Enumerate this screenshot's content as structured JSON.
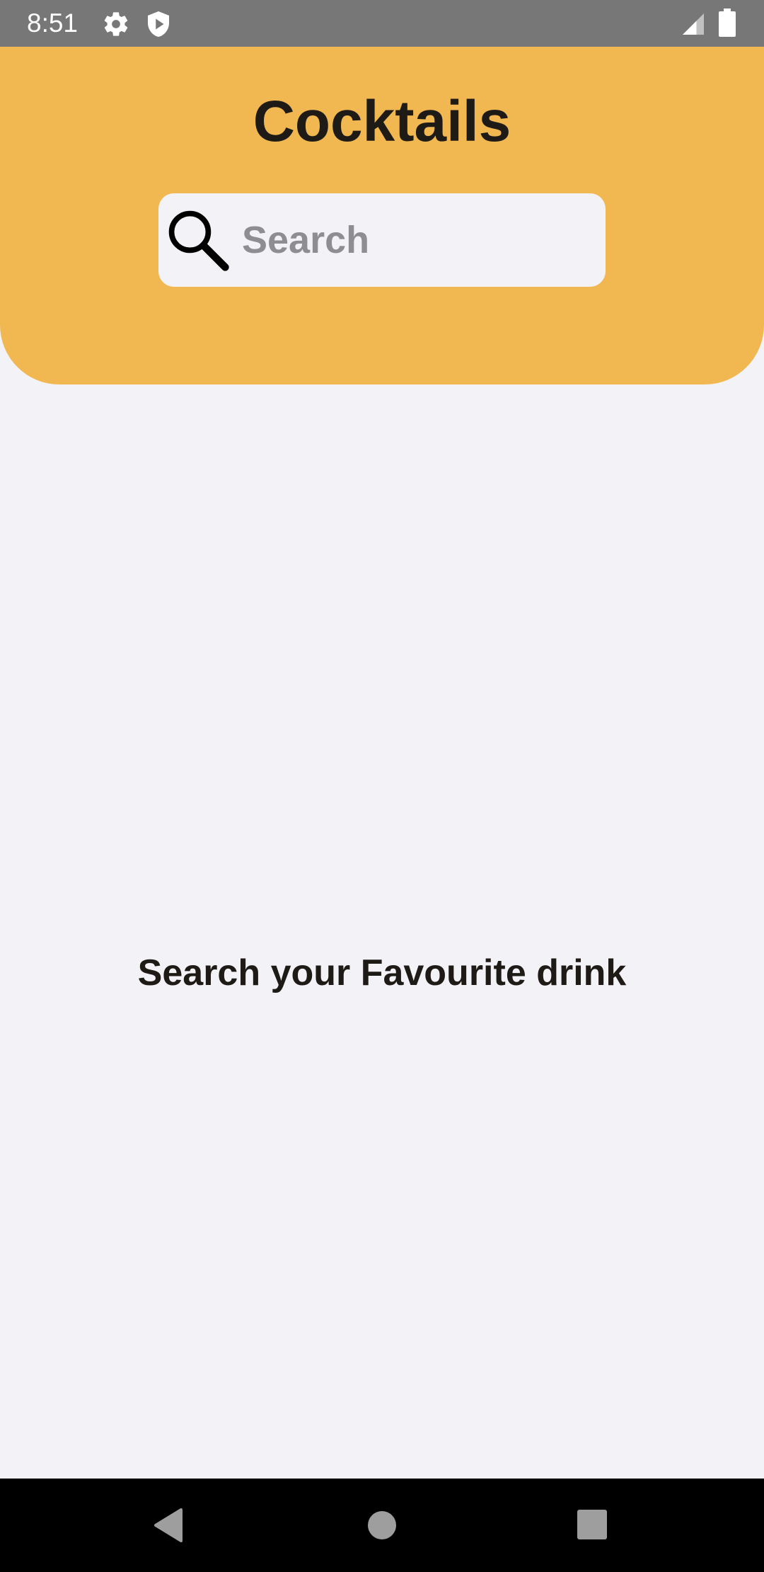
{
  "status_bar": {
    "time": "8:51",
    "icons": [
      "gear-icon",
      "shield-play-icon",
      "signal-icon",
      "battery-icon"
    ]
  },
  "header": {
    "title": "Cocktails",
    "background_color": "#f1b851"
  },
  "search": {
    "placeholder": "Search",
    "value": "",
    "icon": "search-icon"
  },
  "content": {
    "empty_message": "Search your Favourite drink"
  },
  "nav_bar": {
    "buttons": [
      "back-icon",
      "home-icon",
      "recents-icon"
    ]
  }
}
